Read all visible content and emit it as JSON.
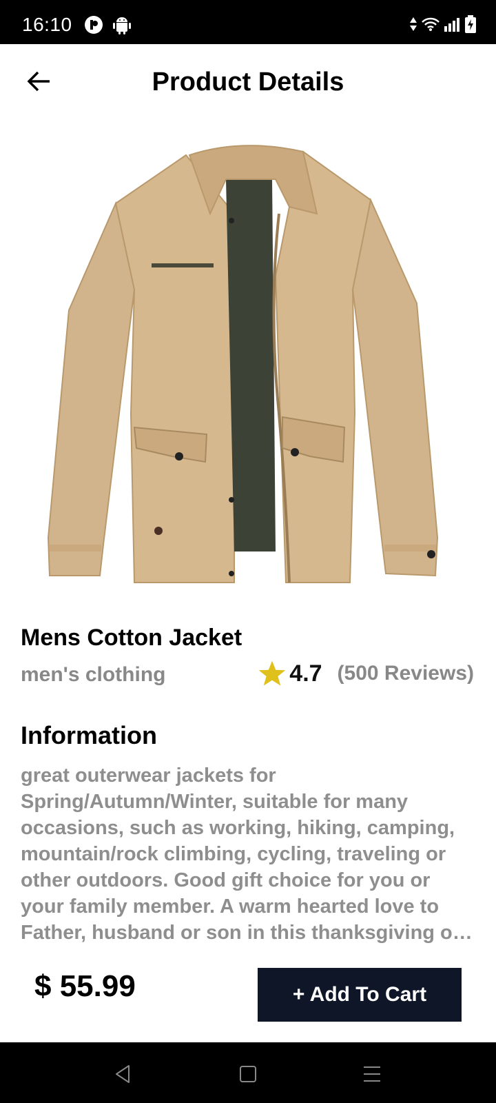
{
  "status_bar": {
    "time": "16:10",
    "left_icons": [
      "pocket-icon",
      "android-icon"
    ],
    "right_icons": [
      "data-arrows-icon",
      "wifi-icon",
      "signal-icon",
      "battery-charging-icon"
    ]
  },
  "header": {
    "back_icon": "arrow-left-icon",
    "title": "Product Details"
  },
  "product": {
    "image_alt": "product-image",
    "name": "Mens Cotton Jacket",
    "category": "men's clothing",
    "rating": "4.7",
    "reviews": "(500 Reviews)",
    "info_title": "Information",
    "description": "great outerwear jackets for Spring/Autumn/Winter, suitable for many occasions, such as working, hiking, camping, mountain/rock climbing, cycling, traveling or other outdoors. Good gift choice for you or your family member. A warm hearted love to Father, husband or son in this thanksgiving or Christmas Day.",
    "price": "$ 55.99"
  },
  "actions": {
    "add_to_cart": "+ Add To Cart"
  },
  "colors": {
    "button_bg": "#0f1627",
    "star": "#e0c01a",
    "muted_text": "#888888",
    "jacket": "#d2b48c"
  },
  "nav_bar": {
    "icons": [
      "back-triangle-icon",
      "home-square-icon",
      "menu-lines-icon"
    ]
  }
}
